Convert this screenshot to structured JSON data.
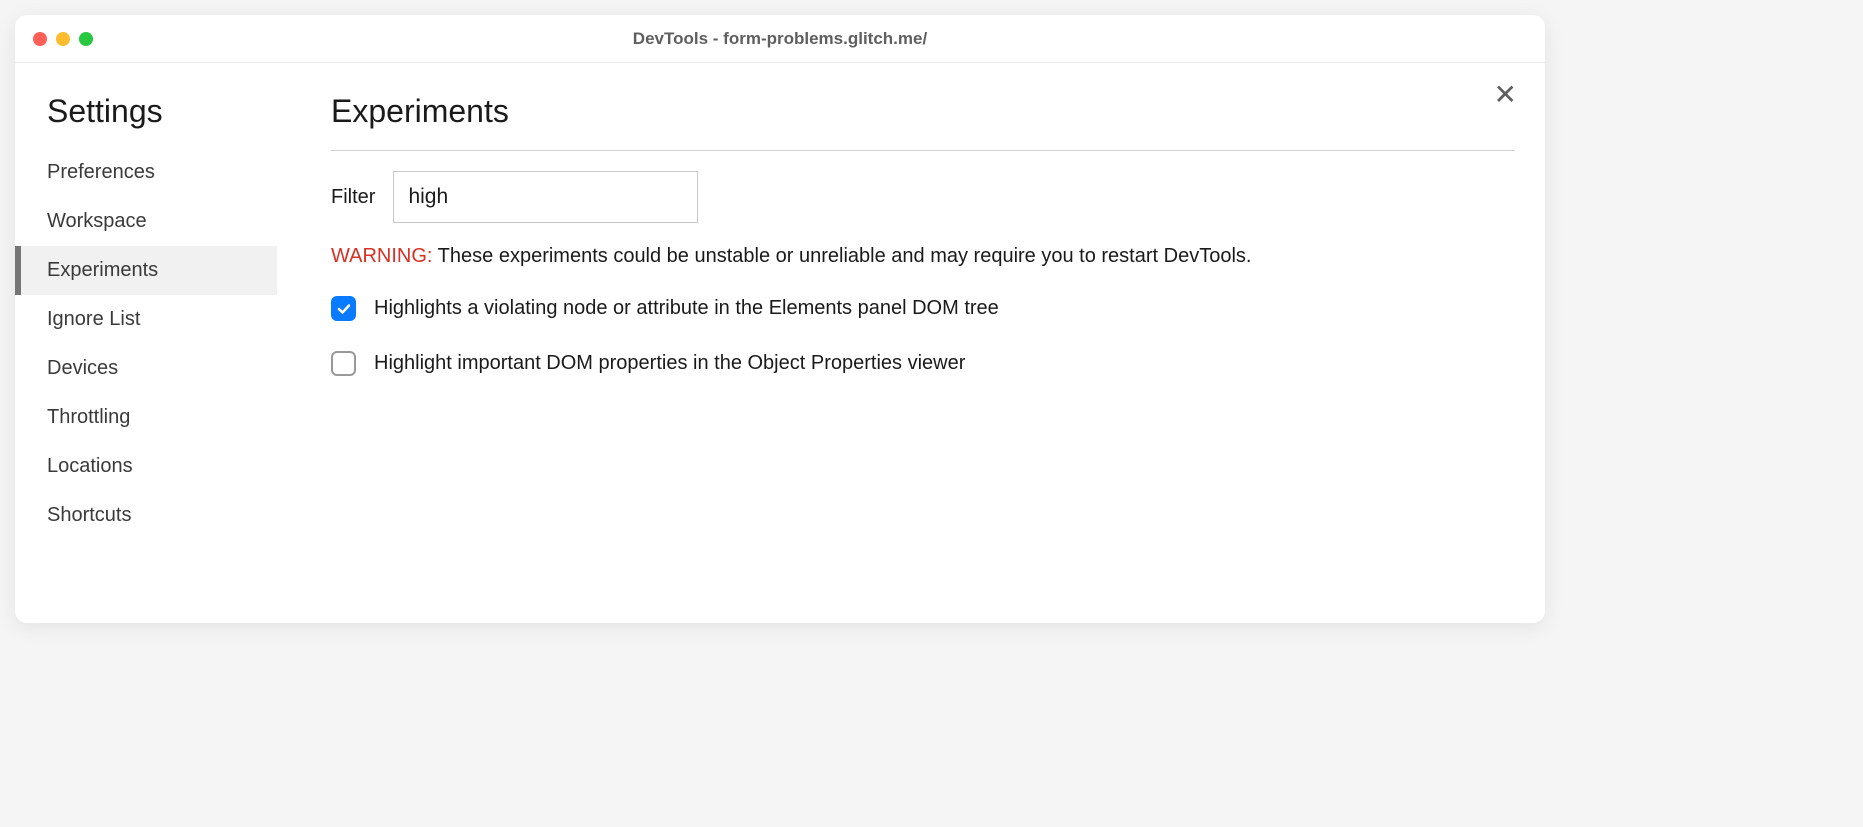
{
  "window": {
    "title": "DevTools - form-problems.glitch.me/"
  },
  "sidebar": {
    "title": "Settings",
    "items": [
      {
        "label": "Preferences",
        "active": false
      },
      {
        "label": "Workspace",
        "active": false
      },
      {
        "label": "Experiments",
        "active": true
      },
      {
        "label": "Ignore List",
        "active": false
      },
      {
        "label": "Devices",
        "active": false
      },
      {
        "label": "Throttling",
        "active": false
      },
      {
        "label": "Locations",
        "active": false
      },
      {
        "label": "Shortcuts",
        "active": false
      }
    ]
  },
  "main": {
    "title": "Experiments",
    "filter_label": "Filter",
    "filter_value": "high",
    "warning_prefix": "WARNING:",
    "warning_text": " These experiments could be unstable or unreliable and may require you to restart DevTools.",
    "experiments": [
      {
        "label": "Highlights a violating node or attribute in the Elements panel DOM tree",
        "checked": true
      },
      {
        "label": "Highlight important DOM properties in the Object Properties viewer",
        "checked": false
      }
    ]
  }
}
